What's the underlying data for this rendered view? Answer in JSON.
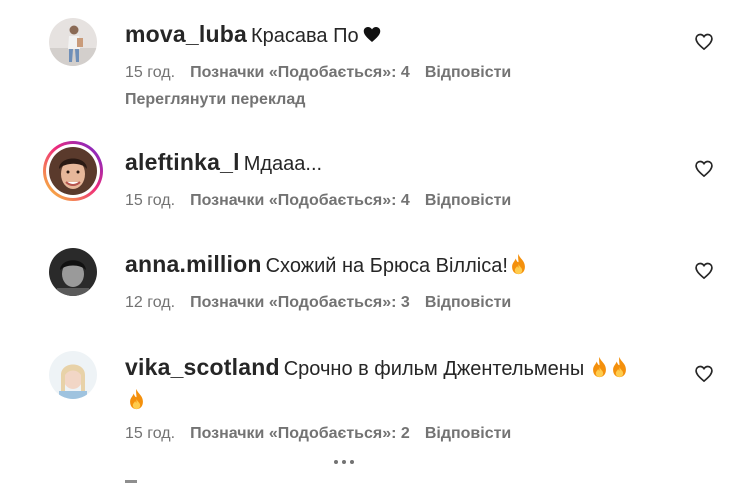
{
  "comments": [
    {
      "username": "mova_luba",
      "text": "Красава По",
      "time": "15 год.",
      "likes": "Позначки «Подобається»: 4",
      "reply": "Відповісти",
      "translate": "Переглянути переклад",
      "avatar_icon": "user-photo-standing",
      "text_icon": "black-heart-emoji"
    },
    {
      "username": "aleftinka_l",
      "text": "Мдааа...",
      "time": "15 год.",
      "likes": "Позначки «Подобається»: 4",
      "reply": "Відповісти",
      "avatar_icon": "user-photo-portrait-story-ring"
    },
    {
      "username": "anna.million",
      "text": "Схожий на Брюса Вілліса!",
      "time": "12 год.",
      "likes": "Позначки «Подобається»: 3",
      "reply": "Відповісти",
      "avatar_icon": "user-photo-dark",
      "text_icon": "fire-emoji"
    },
    {
      "username": "vika_scotland",
      "text": "Срочно в фильм Джентельмены",
      "time": "15 год.",
      "likes": "Позначки «Подобається»: 2",
      "reply": "Відповісти",
      "avatar_icon": "user-photo-light",
      "text_icon": "fire-emoji"
    }
  ],
  "colors": {
    "text": "#262626",
    "meta": "#737373",
    "flame_outer": "#f4900c",
    "flame_inner": "#ffcc4d",
    "story_ring_start": "#f9ce34",
    "story_ring_mid": "#ee2a7b",
    "story_ring_end": "#6228d7"
  }
}
